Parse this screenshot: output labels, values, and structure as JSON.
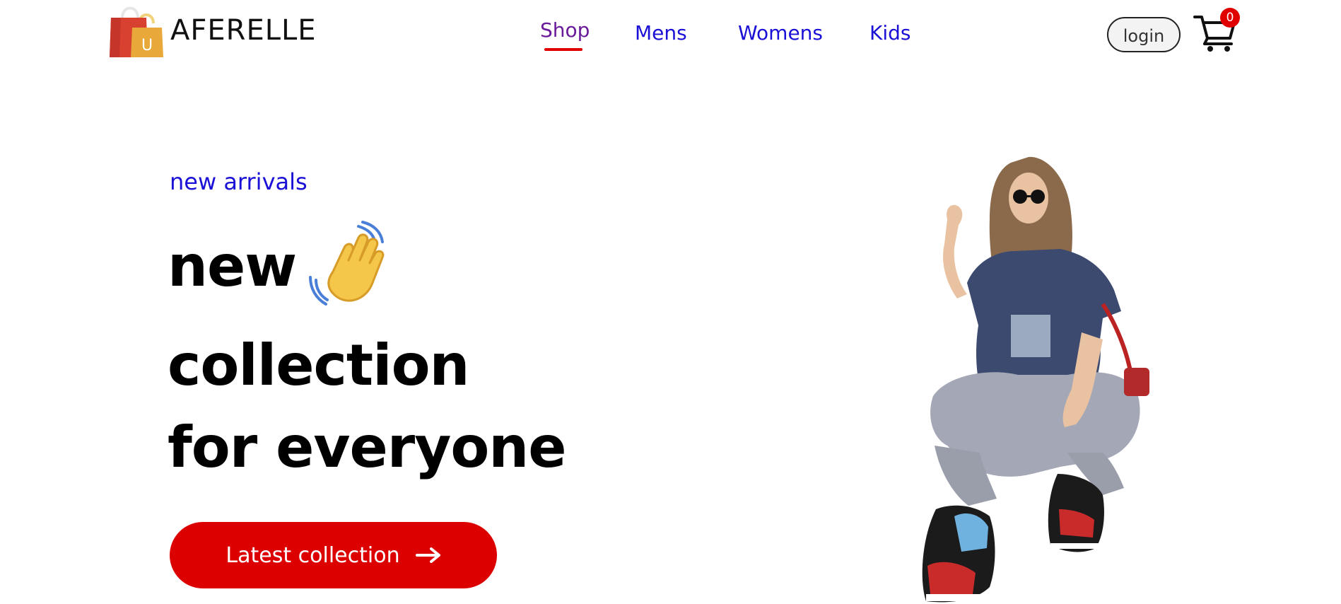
{
  "brand": {
    "name": "AFERELLE",
    "logo_letter": "U",
    "logo_icon": "shopping-bags-icon"
  },
  "nav": {
    "items": [
      {
        "label": "Shop",
        "active": true
      },
      {
        "label": "Mens",
        "active": false
      },
      {
        "label": "Womens",
        "active": false
      },
      {
        "label": "Kids",
        "active": false
      }
    ]
  },
  "header": {
    "login_label": "login",
    "cart_icon": "cart-icon",
    "cart_count": "0"
  },
  "hero": {
    "tag": "new arrivals",
    "line1": "new",
    "line2": "collection",
    "line3": "for everyone",
    "wave_icon": "waving-hand-icon",
    "cta_label": "Latest collection",
    "cta_icon": "arrow-right-icon",
    "image_icon": "model-photo"
  },
  "colors": {
    "accent_red": "#dd0000",
    "link_blue": "#1a10d6",
    "active_purple": "#6a1b9a"
  }
}
